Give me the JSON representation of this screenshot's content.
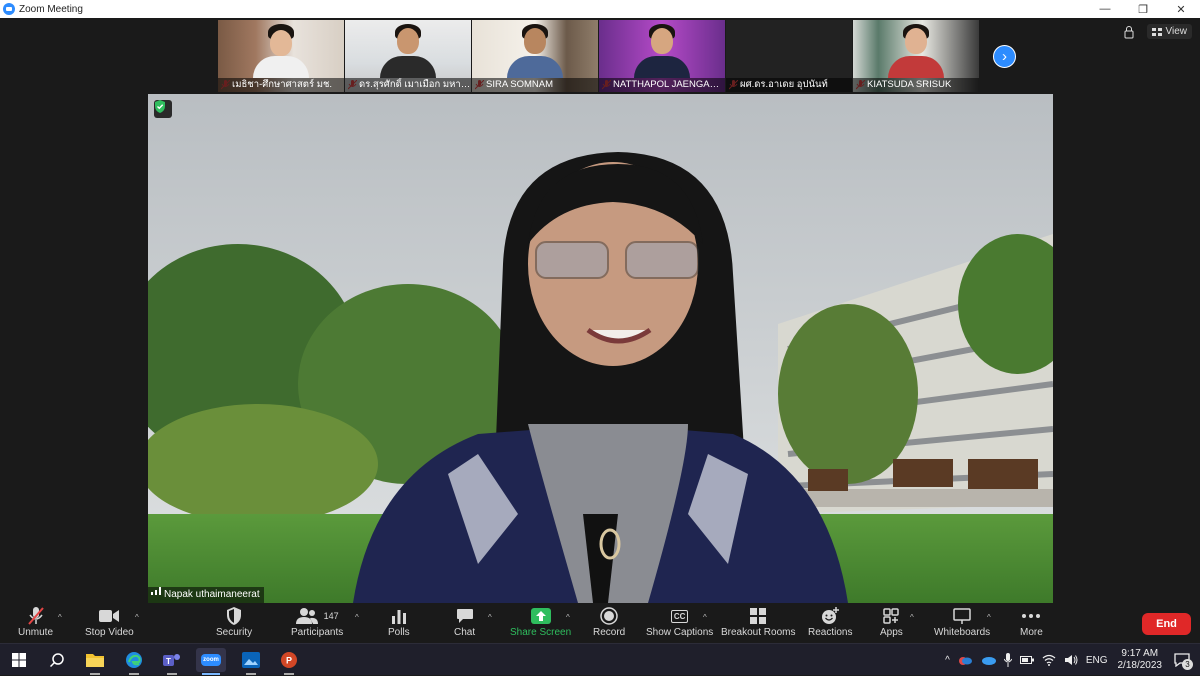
{
  "window": {
    "title": "Zoom Meeting",
    "controls": [
      "minimize-icon",
      "restore-icon",
      "close-icon"
    ]
  },
  "top_right": {
    "view_label": "View"
  },
  "gallery_strip": {
    "tiles": [
      {
        "name": "เมธิชา-ศึกษาศาสตร์ มช.",
        "muted": true
      },
      {
        "name": "ดร.สุรศักดิ์ เมาเมือก มหาวิทยา…",
        "muted": true
      },
      {
        "name": "SIRA SOMNAM",
        "muted": true
      },
      {
        "name": "NATTHAPOL JAENGAK…",
        "muted": true
      },
      {
        "name": "ผศ.ดร.อาเดย อุปนันท์",
        "muted": true
      },
      {
        "name": "KIATSUDA SRISUK",
        "muted": true
      }
    ]
  },
  "speaker": {
    "name": "Napak uthaimaneerat"
  },
  "toolbar": {
    "unmute": "Unmute",
    "stop_video": "Stop Video",
    "security": "Security",
    "participants": "Participants",
    "participants_count": "147",
    "polls": "Polls",
    "chat": "Chat",
    "share_screen": "Share Screen",
    "record": "Record",
    "show_captions": "Show Captions",
    "breakout_rooms": "Breakout Rooms",
    "reactions": "Reactions",
    "apps": "Apps",
    "whiteboards": "Whiteboards",
    "more": "More",
    "end": "End",
    "captions_icon_text": "CC"
  },
  "taskbar": {
    "apps": [
      "windows-start-icon",
      "search-icon",
      "file-explorer-icon",
      "edge-icon",
      "teams-icon",
      "zoom-icon",
      "photos-icon",
      "powerpoint-icon"
    ],
    "zoom_icon_text": "zoom",
    "lang": "ENG",
    "time": "9:17 AM",
    "date": "2/18/2023",
    "notification_count": "3"
  },
  "colors": {
    "zoom_blue": "#2d8cff",
    "end_red": "#e02828",
    "share_green": "#2fbd5e",
    "muted_red": "#e54545"
  }
}
